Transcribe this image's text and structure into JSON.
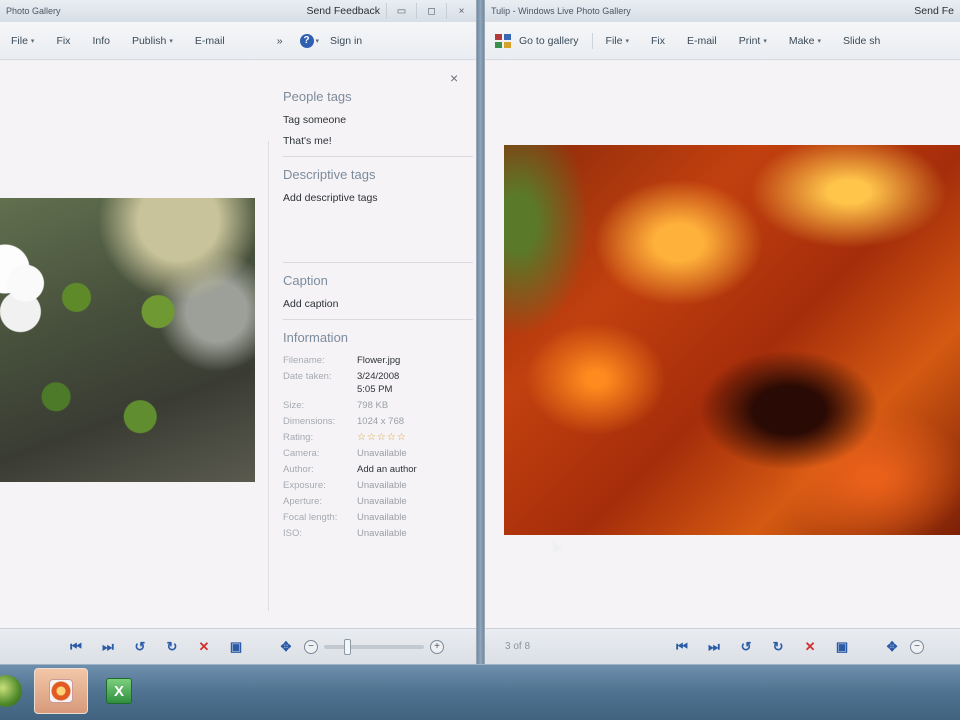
{
  "left_window": {
    "title": "Photo Gallery",
    "send_feedback": "Send Feedback",
    "menu": [
      {
        "label": "File",
        "caret": true
      },
      {
        "label": "Fix",
        "caret": false
      },
      {
        "label": "Info",
        "caret": false
      },
      {
        "label": "Publish",
        "caret": true
      },
      {
        "label": "E-mail",
        "caret": false
      }
    ],
    "more": "»",
    "sign_in": "Sign in",
    "panel": {
      "people_tags_title": "People tags",
      "tag_someone": "Tag someone",
      "thats_me": "That's me!",
      "descriptive_tags_title": "Descriptive tags",
      "add_descriptive_tags": "Add descriptive tags",
      "caption_title": "Caption",
      "add_caption": "Add caption",
      "information_title": "Information",
      "info": {
        "filename_label": "Filename:",
        "filename_value": "Flower.jpg",
        "date_label": "Date taken:",
        "date_value": "3/24/2008",
        "time_value": "5:05 PM",
        "size_label": "Size:",
        "size_value": "798 KB",
        "dimensions_label": "Dimensions:",
        "dimensions_value": "1024 x 768",
        "rating_label": "Rating:",
        "rating_value": "☆☆☆☆☆",
        "camera_label": "Camera:",
        "camera_value": "Unavailable",
        "author_label": "Author:",
        "author_value": "Add an author",
        "exposure_label": "Exposure:",
        "exposure_value": "Unavailable",
        "aperture_label": "Aperture:",
        "aperture_value": "Unavailable",
        "focal_label": "Focal length:",
        "focal_value": "Unavailable",
        "iso_label": "ISO:",
        "iso_value": "Unavailable"
      }
    }
  },
  "right_window": {
    "title": "Tulip - Windows Live Photo Gallery",
    "send_feedback": "Send Fe",
    "go_to_gallery": "Go to gallery",
    "menu": [
      {
        "label": "File",
        "caret": true
      },
      {
        "label": "Fix",
        "caret": false
      },
      {
        "label": "E-mail",
        "caret": false
      },
      {
        "label": "Print",
        "caret": true
      },
      {
        "label": "Make",
        "caret": true
      },
      {
        "label": "Slide sh",
        "caret": false
      }
    ],
    "counter": "3 of 8"
  },
  "glyphs": {
    "close": "×",
    "minimize": "▭",
    "maximize": "◻",
    "prev": "⏮",
    "next": "⏭",
    "rotate_left": "↺",
    "rotate_right": "↻",
    "delete": "✕",
    "slideshow": "▣",
    "fit": "✥",
    "zoom_out": "−",
    "zoom_in": "+",
    "help": "?",
    "excel": "X"
  }
}
